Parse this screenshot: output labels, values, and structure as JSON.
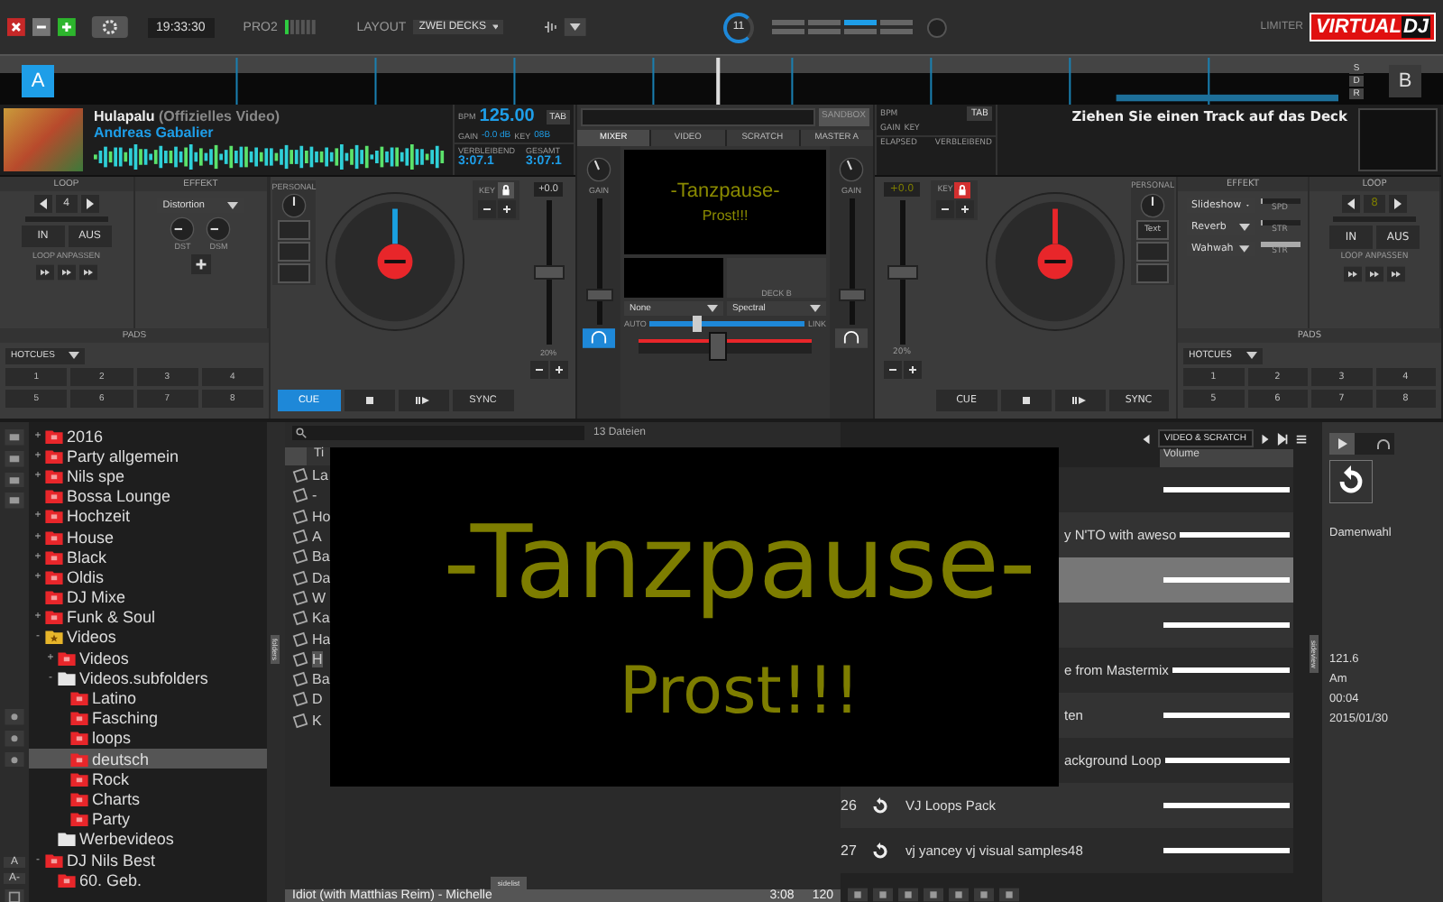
{
  "topbar": {
    "time": "19:33:30",
    "meter_label": "PRO2",
    "layout_label": "LAYOUT",
    "layout": "ZWEI DECKS",
    "counter": "11",
    "pages": [
      {
        "selected": false
      },
      {
        "selected": false
      },
      {
        "selected": true
      },
      {
        "selected": false
      },
      {
        "selected": false
      },
      {
        "selected": false
      },
      {
        "selected": false
      },
      {
        "selected": false
      }
    ],
    "limiter": "LIMITER",
    "logo": [
      "VIRTUAL",
      "DJ"
    ]
  },
  "overview": {
    "decks": [
      {
        "label": "A",
        "selected": true
      },
      {
        "label": "B",
        "selected": false
      }
    ],
    "buttons": [
      "S",
      "D",
      "R"
    ]
  },
  "decks": [
    {
      "loaded": true,
      "has_cover": true,
      "title": "Hulapalu",
      "subtitle": "(Offizielles Video)",
      "artist": "Andreas Gabalier",
      "bpm_label": "BPM",
      "bpm": "125.00",
      "tab": "TAB",
      "gain_label": "GAIN",
      "gain": "-0.0 dB",
      "key_label": "KEY",
      "key": "08B",
      "times": [
        {
          "label": "VERBLEIBEND",
          "value": "3:07.1"
        },
        {
          "label": "GESAMT",
          "value": "3:07.1"
        }
      ],
      "loop": {
        "header": "LOOP",
        "size": "4",
        "in": "IN",
        "out": "AUS",
        "adjust": "LOOP ANPASSEN"
      },
      "effect": {
        "header": "EFFEKT",
        "kind": "knobs",
        "slots": [
          {
            "name": "Distortion"
          }
        ],
        "params": [
          "DST",
          "DSM"
        ]
      },
      "pads": {
        "header": "PADS",
        "mode": "HOTCUES",
        "labels": [
          "1",
          "2",
          "3",
          "4",
          "5",
          "6",
          "7",
          "8"
        ]
      },
      "personal_label": "PERSONAL",
      "key_box": {
        "label": "KEY",
        "locked": false
      },
      "pitch": {
        "value": "+0.0",
        "range": "20%",
        "level": 0.5
      },
      "cue": {
        "label": "CUE",
        "active": true
      },
      "sync": "SYNC"
    },
    {
      "loaded": false,
      "has_cover": false,
      "message": "Ziehen Sie einen Track auf das Deck",
      "bpm_label": "BPM",
      "tab": "TAB",
      "gain_label": "GAIN",
      "key_label": "KEY",
      "times": [
        {
          "label": "ELAPSED"
        },
        {
          "label": "VERBLEIBEND"
        }
      ],
      "loop": {
        "header": "LOOP",
        "size": "8",
        "in": "IN",
        "out": "AUS",
        "adjust": "LOOP ANPASSEN"
      },
      "effect": {
        "header": "EFFEKT",
        "kind": "sliders",
        "slots": [
          {
            "name": "Slideshow",
            "param": "SPD",
            "level": 0.05
          },
          {
            "name": "Reverb",
            "param": "STR",
            "level": 0.05
          },
          {
            "name": "Wahwah",
            "param": "STR",
            "level": 1
          }
        ]
      },
      "pads": {
        "header": "PADS",
        "mode": "HOTCUES",
        "labels": [
          "1",
          "2",
          "3",
          "4",
          "5",
          "6",
          "7",
          "8"
        ]
      },
      "personal_label": "PERSONAL",
      "personal_buttons": [
        "Text"
      ],
      "key_box": {
        "label": "KEY",
        "locked": true
      },
      "pitch": {
        "value": "+0.0",
        "range": "20%",
        "level": 0.5
      },
      "cue": {
        "label": "CUE",
        "active": false
      },
      "sync": "SYNC"
    }
  ],
  "mixer": {
    "sandbox": "SANDBOX",
    "tabs": [
      {
        "label": "MIXER",
        "selected": true
      },
      {
        "label": "VIDEO",
        "selected": false
      },
      {
        "label": "SCRATCH",
        "selected": false
      },
      {
        "label": "MASTER A",
        "selected": false
      }
    ],
    "gains": [
      {
        "label": "GAIN",
        "level": 0.2,
        "listen": true
      },
      {
        "label": "GAIN",
        "level": 0.2,
        "listen": false
      }
    ],
    "preview": {
      "line1": "-Tanzpause-",
      "line2": "Prost!!!"
    },
    "deck_preview": "DECK B",
    "transitions": [
      "None",
      "Spectral"
    ],
    "auto": "AUTO",
    "link": "LINK",
    "video_fader": {
      "level": 0.3
    },
    "crossfader": {
      "level": 0.45
    }
  },
  "browser": {
    "font_buttons": [
      "A",
      "A-"
    ],
    "folders_tab": "folders",
    "folders": [
      {
        "name": "2016",
        "kind": "red",
        "expander": "+",
        "selected": false
      },
      {
        "name": "Party allgemein",
        "kind": "red",
        "expander": "+",
        "selected": false
      },
      {
        "name": "Nils spe",
        "kind": "red",
        "expander": "+",
        "selected": false
      },
      {
        "name": "Bossa Lounge",
        "kind": "red",
        "selected": false
      },
      {
        "name": "Hochzeit",
        "kind": "red",
        "expander": "+",
        "selected": false
      },
      {
        "name": "House",
        "kind": "red",
        "expander": "+",
        "selected": false
      },
      {
        "name": "Black",
        "kind": "red",
        "expander": "+",
        "selected": false
      },
      {
        "name": "Oldis",
        "kind": "red",
        "expander": "+",
        "selected": false
      },
      {
        "name": "DJ Mixe",
        "kind": "red",
        "selected": false
      },
      {
        "name": "Funk & Soul",
        "kind": "red",
        "expander": "+",
        "selected": false
      },
      {
        "name": "Videos",
        "kind": "star",
        "expander": "-",
        "selected": false,
        "children": [
          {
            "name": "Videos",
            "kind": "red",
            "expander": "+",
            "selected": false
          },
          {
            "name": "Videos.subfolders",
            "kind": "plain",
            "expander": "-",
            "selected": false,
            "children": [
              {
                "name": "Latino",
                "kind": "red",
                "selected": false
              },
              {
                "name": "Fasching",
                "kind": "red",
                "selected": false
              },
              {
                "name": "loops",
                "kind": "red",
                "selected": false
              },
              {
                "name": "deutsch",
                "kind": "red",
                "selected": true
              },
              {
                "name": "Rock",
                "kind": "red",
                "selected": false
              },
              {
                "name": "Charts",
                "kind": "red",
                "selected": false
              },
              {
                "name": "Party",
                "kind": "red",
                "selected": false
              }
            ]
          },
          {
            "name": "Werbevideos",
            "kind": "plain",
            "selected": false
          }
        ]
      },
      {
        "name": "DJ Nils Best",
        "kind": "red",
        "expander": "-",
        "selected": false,
        "children": [
          {
            "name": "60. Geb.",
            "kind": "red",
            "selected": false
          }
        ]
      }
    ],
    "files": {
      "count": "13 Dateien",
      "column_1": "Ti",
      "rows": [
        {
          "text": "La",
          "selected": false
        },
        {
          "text": "-",
          "selected": false
        },
        {
          "text": "Ho",
          "selected": false
        },
        {
          "text": "A",
          "selected": false
        },
        {
          "text": "Ba",
          "selected": false
        },
        {
          "text": "Da",
          "selected": false
        },
        {
          "text": "W",
          "selected": false
        },
        {
          "text": "Ka",
          "selected": false
        },
        {
          "text": "Ha",
          "selected": false
        },
        {
          "text": "H",
          "selected": true
        },
        {
          "text": "Ba",
          "selected": false
        },
        {
          "text": "D",
          "selected": false
        },
        {
          "text": "K",
          "selected": false
        }
      ],
      "bottom_row": {
        "title": "Idiot (with Matthias Reim) - Michelle",
        "length": "3:08",
        "bpm": "120"
      },
      "tab": "sidelist"
    },
    "sampler": {
      "mode": "VIDEO & SCRATCH",
      "volume_header": "Volume",
      "tab": "sideview",
      "rows": [
        {
          "selected": false
        },
        {
          "name": "y N'TO with aweso",
          "selected": false
        },
        {
          "selected": true
        },
        {
          "selected": false
        },
        {
          "name": "e from Mastermix",
          "selected": false
        },
        {
          "name": "ten",
          "selected": false
        },
        {
          "name": "ackground Loop",
          "selected": false
        },
        {
          "number": "26",
          "name": "VJ Loops Pack",
          "selected": false
        },
        {
          "number": "27",
          "name": "vj yancey vj visual samples48",
          "selected": false
        }
      ]
    },
    "info": {
      "track": "Damenwahl",
      "details": [
        "121.6",
        "Am",
        "00:04",
        "2015/01/30"
      ]
    }
  },
  "overlay": {
    "line1": "-Tanzpause-",
    "line2": "Prost!!!"
  }
}
